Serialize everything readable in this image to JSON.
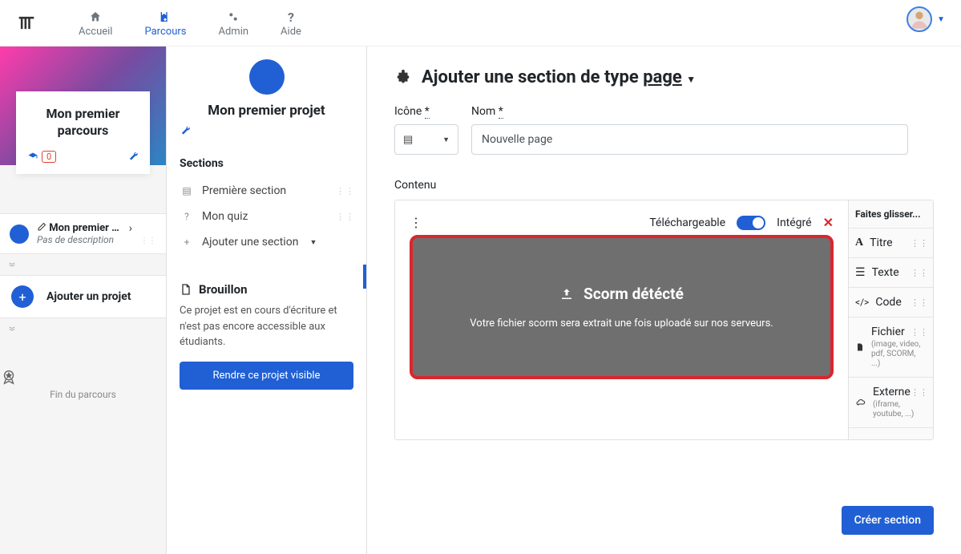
{
  "nav": {
    "accueil": "Accueil",
    "parcours": "Parcours",
    "admin": "Admin",
    "aide": "Aide"
  },
  "course": {
    "title": "Mon premier parcours",
    "students": "0"
  },
  "project": {
    "title": "Mon premier pro...",
    "desc": "Pas de description",
    "add": "Ajouter un projet"
  },
  "fin": "Fin du parcours",
  "col2": {
    "title": "Mon premier projet",
    "sections_h": "Sections",
    "items": [
      "Première section",
      "Mon quiz"
    ],
    "add": "Ajouter une section"
  },
  "draft": {
    "h": "Brouillon",
    "txt": "Ce projet est en cours d'écriture et n'est pas encore accessible aux étudiants.",
    "btn": "Rendre ce projet visible"
  },
  "page": {
    "prefix": "Ajouter une section de type",
    "type": "page",
    "icone": "Icône",
    "asterisk": "*",
    "nom": "Nom",
    "name_val": "Nouvelle page",
    "contenu": "Contenu"
  },
  "editor": {
    "dl": "Téléchargeable",
    "integre": "Intégré"
  },
  "scorm": {
    "h": "Scorm détécté",
    "p": "Votre fichier scorm sera extrait une fois uploadé sur nos serveurs."
  },
  "palette": {
    "h": "Faites glisser...",
    "titre": "Titre",
    "texte": "Texte",
    "code": "Code",
    "fichier": "Fichier",
    "fichier_sub": "(image, video, pdf, SCORM, ...)",
    "externe": "Externe",
    "externe_sub": "(iframe, youtube, ...)"
  },
  "btn_create": "Créer section"
}
